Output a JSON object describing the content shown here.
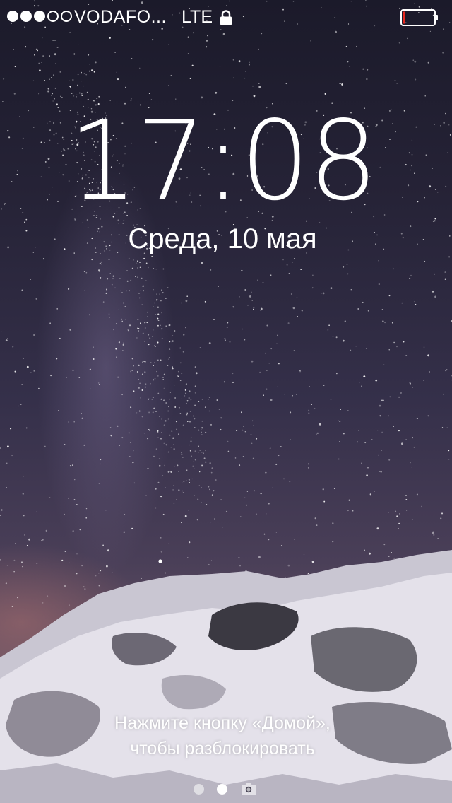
{
  "status_bar": {
    "signal_bars_filled": 3,
    "signal_bars_total": 5,
    "carrier": "VODAFO...",
    "network": "LTE",
    "lock_icon": "lock-icon",
    "battery_level": 0.08,
    "battery_level_color": "#e8291f"
  },
  "lock_screen": {
    "time": "17:08",
    "date": "Среда, 10 мая",
    "unlock_line_1": "Нажмите кнопку «Домой»,",
    "unlock_line_2": "чтобы разблокировать"
  },
  "page_indicator": {
    "pages": 2,
    "active_page": 2,
    "camera_icon": "camera-icon"
  }
}
